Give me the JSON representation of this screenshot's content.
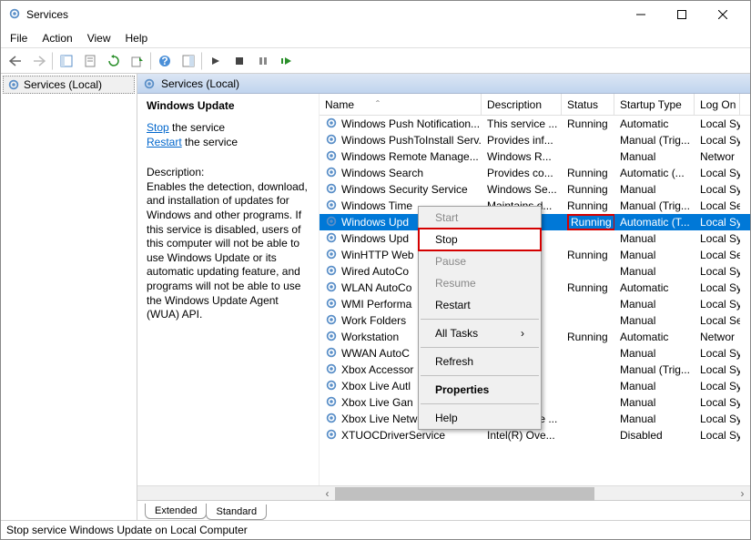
{
  "window": {
    "title": "Services"
  },
  "menus": {
    "file": "File",
    "action": "Action",
    "view": "View",
    "help": "Help"
  },
  "tree": {
    "root": "Services (Local)"
  },
  "content_header": "Services (Local)",
  "detail": {
    "title": "Windows Update",
    "stop_link": "Stop",
    "stop_suffix": " the service",
    "restart_link": "Restart",
    "restart_suffix": " the service",
    "desc_label": "Description:",
    "description": "Enables the detection, download, and installation of updates for Windows and other programs. If this service is disabled, users of this computer will not be able to use Windows Update or its automatic updating feature, and programs will not be able to use the Windows Update Agent (WUA) API."
  },
  "columns": {
    "name": "Name",
    "description": "Description",
    "status": "Status",
    "startup": "Startup Type",
    "logon": "Log On"
  },
  "rows": [
    {
      "name": "Windows Push Notification...",
      "desc": "This service ...",
      "status": "Running",
      "startup": "Automatic",
      "logon": "Local Sy"
    },
    {
      "name": "Windows PushToInstall Serv...",
      "desc": "Provides inf...",
      "status": "",
      "startup": "Manual (Trig...",
      "logon": "Local Sy"
    },
    {
      "name": "Windows Remote Manage...",
      "desc": "Windows R...",
      "status": "",
      "startup": "Manual",
      "logon": "Networ"
    },
    {
      "name": "Windows Search",
      "desc": "Provides co...",
      "status": "Running",
      "startup": "Automatic (...",
      "logon": "Local Sy"
    },
    {
      "name": "Windows Security Service",
      "desc": "Windows Se...",
      "status": "Running",
      "startup": "Manual",
      "logon": "Local Sy"
    },
    {
      "name": "Windows Time",
      "desc": "Maintains d...",
      "status": "Running",
      "startup": "Manual (Trig...",
      "logon": "Local Se"
    },
    {
      "name": "Windows Upd",
      "desc": "",
      "status": "Running",
      "startup": "Automatic (T...",
      "logon": "Local Sy",
      "selected": true
    },
    {
      "name": "Windows Upd",
      "desc": "",
      "status": "",
      "startup": "Manual",
      "logon": "Local Sy"
    },
    {
      "name": "WinHTTP Web",
      "desc": "...",
      "status": "Running",
      "startup": "Manual",
      "logon": "Local Se"
    },
    {
      "name": "Wired AutoCo",
      "desc": "...",
      "status": "",
      "startup": "Manual",
      "logon": "Local Sy"
    },
    {
      "name": "WLAN AutoCo",
      "desc": "...",
      "status": "Running",
      "startup": "Automatic",
      "logon": "Local Sy"
    },
    {
      "name": "WMI Performa",
      "desc": "",
      "status": "",
      "startup": "Manual",
      "logon": "Local Sy"
    },
    {
      "name": "Work Folders",
      "desc": "...",
      "status": "",
      "startup": "Manual",
      "logon": "Local Se"
    },
    {
      "name": "Workstation",
      "desc": "...",
      "status": "Running",
      "startup": "Automatic",
      "logon": "Networ"
    },
    {
      "name": "WWAN AutoC",
      "desc": "",
      "status": "",
      "startup": "Manual",
      "logon": "Local Sy"
    },
    {
      "name": "Xbox Accessor",
      "desc": "",
      "status": "",
      "startup": "Manual (Trig...",
      "logon": "Local Sy"
    },
    {
      "name": "Xbox Live Autl",
      "desc": "",
      "status": "",
      "startup": "Manual",
      "logon": "Local Sy"
    },
    {
      "name": "Xbox Live Gan",
      "desc": "",
      "status": "",
      "startup": "Manual",
      "logon": "Local Sy"
    },
    {
      "name": "Xbox Live Networking Service",
      "desc": "This service ...",
      "status": "",
      "startup": "Manual",
      "logon": "Local Sy"
    },
    {
      "name": "XTUOCDriverService",
      "desc": "Intel(R) Ove...",
      "status": "",
      "startup": "Disabled",
      "logon": "Local Sy"
    }
  ],
  "context_menu": {
    "start": "Start",
    "stop": "Stop",
    "pause": "Pause",
    "resume": "Resume",
    "restart": "Restart",
    "all_tasks": "All Tasks",
    "refresh": "Refresh",
    "properties": "Properties",
    "help": "Help"
  },
  "tabs": {
    "extended": "Extended",
    "standard": "Standard"
  },
  "statusbar": "Stop service Windows Update on Local Computer"
}
